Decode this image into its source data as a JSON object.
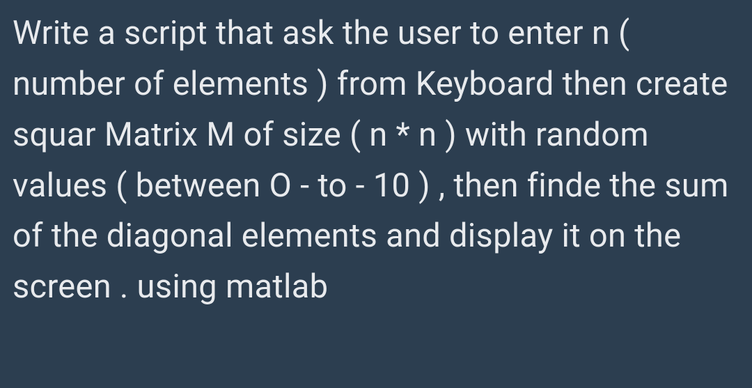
{
  "document": {
    "text": "Write a script that ask the user to enter n ( number of elements ) from Keyboard then create squar Matrix M of size ( n * n ) with random values ( between O - to - 10 ) , then finde the sum of the diagonal elements and display it on the screen . using matlab"
  }
}
